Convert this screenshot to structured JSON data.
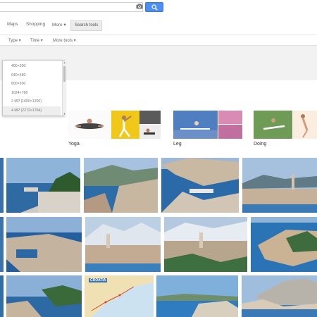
{
  "nav": {
    "maps": "Maps",
    "shopping": "Shopping",
    "more": "More ▾",
    "search_tools": "Search tools"
  },
  "filters": {
    "type": "Type ▾",
    "time": "Time ▾",
    "more_tools": "More tools ▾"
  },
  "size_menu": {
    "options": [
      "400×300",
      "640×480",
      "800×600",
      "1024×768",
      "2 MP (1600×1200)",
      "4 MP (2272×1704)"
    ],
    "selected_index": 5
  },
  "related": [
    {
      "label": "Yoga"
    },
    {
      "label": "Leg"
    },
    {
      "label": "Doing"
    }
  ],
  "map_tile": {
    "title": "CROATIA"
  },
  "colors": {
    "search_button": "#4d8ff1",
    "sea": "#2a6fa8",
    "sky": "#8fb5d8"
  }
}
